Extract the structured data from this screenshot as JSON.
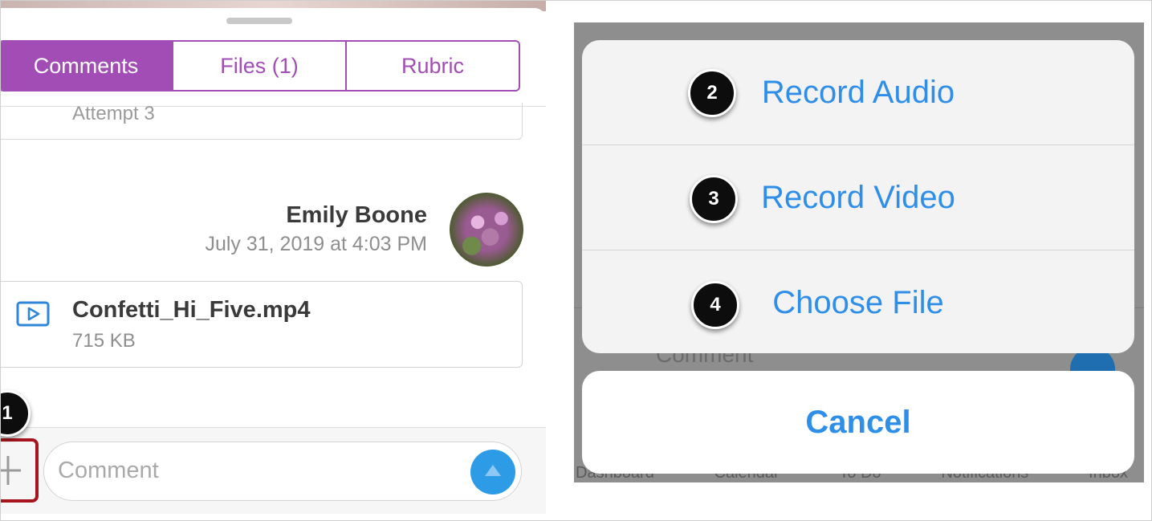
{
  "left": {
    "tabs": [
      "Comments",
      "Files (1)",
      "Rubric"
    ],
    "attempt_label": "Attempt 3",
    "comment": {
      "author": "Emily Boone",
      "timestamp": "July 31, 2019 at 4:03 PM"
    },
    "attachment": {
      "file_name": "Confetti_Hi_Five.mp4",
      "file_size": "715 KB",
      "icon": "video-file-icon"
    },
    "callout_1": "1",
    "comment_placeholder": "Comment",
    "add_icon": "plus-icon",
    "send_icon": "send-arrow-icon"
  },
  "right": {
    "actions": [
      {
        "callout": "2",
        "label": "Record Audio"
      },
      {
        "callout": "3",
        "label": "Record Video"
      },
      {
        "callout": "4",
        "label": "Choose File"
      }
    ],
    "cancel_label": "Cancel",
    "background_comment": "Comment",
    "background_tabs": [
      "Dashboard",
      "Calendar",
      "To Do",
      "Notifications",
      "Inbox"
    ]
  },
  "colors": {
    "accent_purple": "#a24db5",
    "action_blue": "#2f8fe8",
    "send_blue": "#2e9be6",
    "highlight_red": "#a8141e"
  }
}
